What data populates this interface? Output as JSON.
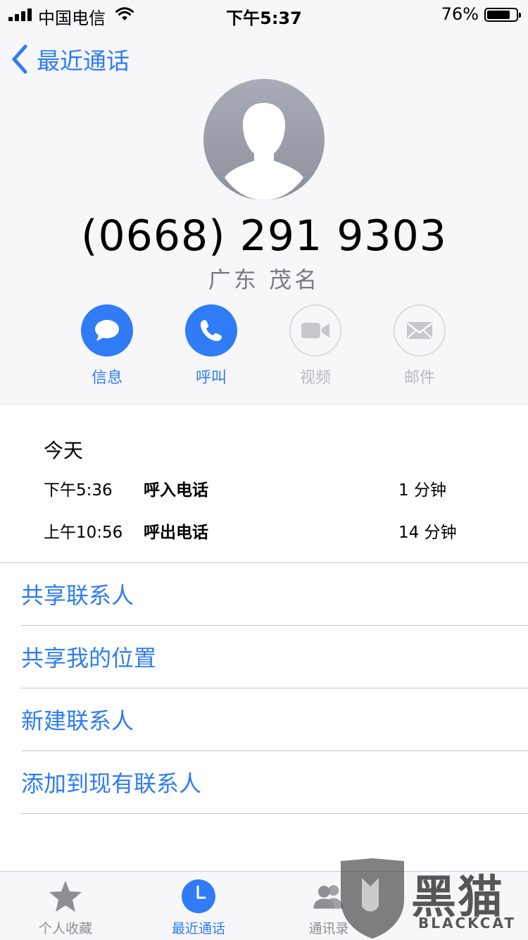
{
  "status_bar": {
    "carrier": "中国电信",
    "time": "下午5:37",
    "battery_percent": "76%"
  },
  "nav": {
    "back_label": "最近通话"
  },
  "contact": {
    "phone_number": "(0668) 291 9303",
    "location": "广东 茂名"
  },
  "actions": [
    {
      "label": "信息",
      "icon": "message-icon",
      "enabled": true
    },
    {
      "label": "呼叫",
      "icon": "phone-icon",
      "enabled": true
    },
    {
      "label": "视频",
      "icon": "video-icon",
      "enabled": false
    },
    {
      "label": "邮件",
      "icon": "mail-icon",
      "enabled": false
    }
  ],
  "history": {
    "title": "今天",
    "calls": [
      {
        "time": "下午5:36",
        "type": "呼入电话",
        "duration": "1 分钟"
      },
      {
        "time": "上午10:56",
        "type": "呼出电话",
        "duration": "14 分钟"
      }
    ]
  },
  "options": [
    {
      "label": "共享联系人"
    },
    {
      "label": "共享我的位置"
    },
    {
      "label": "新建联系人"
    },
    {
      "label": "添加到现有联系人"
    }
  ],
  "tab_bar": {
    "tabs": [
      {
        "label": "个人收藏",
        "icon": "star-icon",
        "active": false
      },
      {
        "label": "最近通话",
        "icon": "clock-icon",
        "active": true
      },
      {
        "label": "通讯录",
        "icon": "contacts-icon",
        "active": false
      }
    ]
  },
  "watermark": {
    "text": "黑猫",
    "sub": "BLACKCAT"
  },
  "colors": {
    "accent": "#2f7cf6",
    "header_bg": "#f7f7f9",
    "disabled": "#b9b9be"
  }
}
